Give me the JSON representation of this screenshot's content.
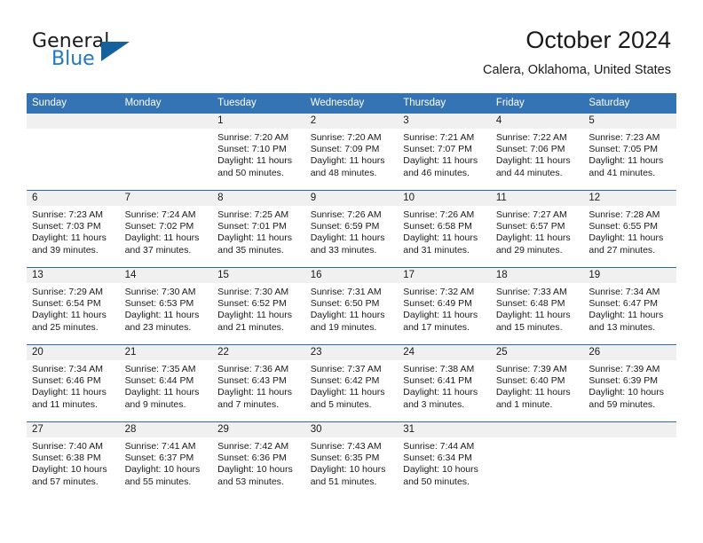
{
  "brand": {
    "word1": "General",
    "word2": "Blue",
    "triangle_color": "#15619e",
    "blue_text_color": "#1f78c1"
  },
  "header": {
    "title": "October 2024",
    "subtitle": "Calera, Oklahoma, United States"
  },
  "theme": {
    "header_row_bg": "#3474b4",
    "row_separator": "#2b6cab",
    "daynum_band_bg": "#f0f0f0",
    "text": "#1a1a1a"
  },
  "weekday_headers": [
    "Sunday",
    "Monday",
    "Tuesday",
    "Wednesday",
    "Thursday",
    "Friday",
    "Saturday"
  ],
  "labels": {
    "sunrise": "Sunrise:",
    "sunset": "Sunset:",
    "daylight": "Daylight:"
  },
  "weeks": [
    [
      {
        "day": ""
      },
      {
        "day": ""
      },
      {
        "day": "1",
        "sunrise": "Sunrise: 7:20 AM",
        "sunset": "Sunset: 7:10 PM",
        "daylight": "Daylight: 11 hours and 50 minutes."
      },
      {
        "day": "2",
        "sunrise": "Sunrise: 7:20 AM",
        "sunset": "Sunset: 7:09 PM",
        "daylight": "Daylight: 11 hours and 48 minutes."
      },
      {
        "day": "3",
        "sunrise": "Sunrise: 7:21 AM",
        "sunset": "Sunset: 7:07 PM",
        "daylight": "Daylight: 11 hours and 46 minutes."
      },
      {
        "day": "4",
        "sunrise": "Sunrise: 7:22 AM",
        "sunset": "Sunset: 7:06 PM",
        "daylight": "Daylight: 11 hours and 44 minutes."
      },
      {
        "day": "5",
        "sunrise": "Sunrise: 7:23 AM",
        "sunset": "Sunset: 7:05 PM",
        "daylight": "Daylight: 11 hours and 41 minutes."
      }
    ],
    [
      {
        "day": "6",
        "sunrise": "Sunrise: 7:23 AM",
        "sunset": "Sunset: 7:03 PM",
        "daylight": "Daylight: 11 hours and 39 minutes."
      },
      {
        "day": "7",
        "sunrise": "Sunrise: 7:24 AM",
        "sunset": "Sunset: 7:02 PM",
        "daylight": "Daylight: 11 hours and 37 minutes."
      },
      {
        "day": "8",
        "sunrise": "Sunrise: 7:25 AM",
        "sunset": "Sunset: 7:01 PM",
        "daylight": "Daylight: 11 hours and 35 minutes."
      },
      {
        "day": "9",
        "sunrise": "Sunrise: 7:26 AM",
        "sunset": "Sunset: 6:59 PM",
        "daylight": "Daylight: 11 hours and 33 minutes."
      },
      {
        "day": "10",
        "sunrise": "Sunrise: 7:26 AM",
        "sunset": "Sunset: 6:58 PM",
        "daylight": "Daylight: 11 hours and 31 minutes."
      },
      {
        "day": "11",
        "sunrise": "Sunrise: 7:27 AM",
        "sunset": "Sunset: 6:57 PM",
        "daylight": "Daylight: 11 hours and 29 minutes."
      },
      {
        "day": "12",
        "sunrise": "Sunrise: 7:28 AM",
        "sunset": "Sunset: 6:55 PM",
        "daylight": "Daylight: 11 hours and 27 minutes."
      }
    ],
    [
      {
        "day": "13",
        "sunrise": "Sunrise: 7:29 AM",
        "sunset": "Sunset: 6:54 PM",
        "daylight": "Daylight: 11 hours and 25 minutes."
      },
      {
        "day": "14",
        "sunrise": "Sunrise: 7:30 AM",
        "sunset": "Sunset: 6:53 PM",
        "daylight": "Daylight: 11 hours and 23 minutes."
      },
      {
        "day": "15",
        "sunrise": "Sunrise: 7:30 AM",
        "sunset": "Sunset: 6:52 PM",
        "daylight": "Daylight: 11 hours and 21 minutes."
      },
      {
        "day": "16",
        "sunrise": "Sunrise: 7:31 AM",
        "sunset": "Sunset: 6:50 PM",
        "daylight": "Daylight: 11 hours and 19 minutes."
      },
      {
        "day": "17",
        "sunrise": "Sunrise: 7:32 AM",
        "sunset": "Sunset: 6:49 PM",
        "daylight": "Daylight: 11 hours and 17 minutes."
      },
      {
        "day": "18",
        "sunrise": "Sunrise: 7:33 AM",
        "sunset": "Sunset: 6:48 PM",
        "daylight": "Daylight: 11 hours and 15 minutes."
      },
      {
        "day": "19",
        "sunrise": "Sunrise: 7:34 AM",
        "sunset": "Sunset: 6:47 PM",
        "daylight": "Daylight: 11 hours and 13 minutes."
      }
    ],
    [
      {
        "day": "20",
        "sunrise": "Sunrise: 7:34 AM",
        "sunset": "Sunset: 6:46 PM",
        "daylight": "Daylight: 11 hours and 11 minutes."
      },
      {
        "day": "21",
        "sunrise": "Sunrise: 7:35 AM",
        "sunset": "Sunset: 6:44 PM",
        "daylight": "Daylight: 11 hours and 9 minutes."
      },
      {
        "day": "22",
        "sunrise": "Sunrise: 7:36 AM",
        "sunset": "Sunset: 6:43 PM",
        "daylight": "Daylight: 11 hours and 7 minutes."
      },
      {
        "day": "23",
        "sunrise": "Sunrise: 7:37 AM",
        "sunset": "Sunset: 6:42 PM",
        "daylight": "Daylight: 11 hours and 5 minutes."
      },
      {
        "day": "24",
        "sunrise": "Sunrise: 7:38 AM",
        "sunset": "Sunset: 6:41 PM",
        "daylight": "Daylight: 11 hours and 3 minutes."
      },
      {
        "day": "25",
        "sunrise": "Sunrise: 7:39 AM",
        "sunset": "Sunset: 6:40 PM",
        "daylight": "Daylight: 11 hours and 1 minute."
      },
      {
        "day": "26",
        "sunrise": "Sunrise: 7:39 AM",
        "sunset": "Sunset: 6:39 PM",
        "daylight": "Daylight: 10 hours and 59 minutes."
      }
    ],
    [
      {
        "day": "27",
        "sunrise": "Sunrise: 7:40 AM",
        "sunset": "Sunset: 6:38 PM",
        "daylight": "Daylight: 10 hours and 57 minutes."
      },
      {
        "day": "28",
        "sunrise": "Sunrise: 7:41 AM",
        "sunset": "Sunset: 6:37 PM",
        "daylight": "Daylight: 10 hours and 55 minutes."
      },
      {
        "day": "29",
        "sunrise": "Sunrise: 7:42 AM",
        "sunset": "Sunset: 6:36 PM",
        "daylight": "Daylight: 10 hours and 53 minutes."
      },
      {
        "day": "30",
        "sunrise": "Sunrise: 7:43 AM",
        "sunset": "Sunset: 6:35 PM",
        "daylight": "Daylight: 10 hours and 51 minutes."
      },
      {
        "day": "31",
        "sunrise": "Sunrise: 7:44 AM",
        "sunset": "Sunset: 6:34 PM",
        "daylight": "Daylight: 10 hours and 50 minutes."
      },
      {
        "day": ""
      },
      {
        "day": ""
      }
    ]
  ]
}
